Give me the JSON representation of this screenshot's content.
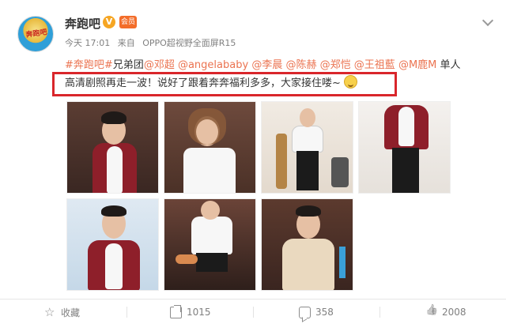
{
  "header": {
    "username": "奔跑吧",
    "verified_icon": "V",
    "avatar_logo": "奔跑吧",
    "member_icon": "会员",
    "time": "今天 17:01",
    "source_prefix": "来自",
    "device": "OPPO超视野全面屏R15"
  },
  "post": {
    "hashtag": "#奔跑吧#",
    "text_after_hashtag": "兄弟团",
    "mentions": [
      "@邓超",
      "@angelababy",
      "@李晨",
      "@陈赫",
      "@郑恺",
      "@王祖藍",
      "@M鹿M"
    ],
    "text_end_line1": "单人",
    "line2": "高清剧照再走一波！说好了跟着奔奔福利多多，大家接住喽~"
  },
  "photos": [
    {
      "label": "photo-1"
    },
    {
      "label": "photo-2"
    },
    {
      "label": "photo-3"
    },
    {
      "label": "photo-4"
    },
    {
      "label": "photo-5"
    },
    {
      "label": "photo-6"
    },
    {
      "label": "photo-7"
    }
  ],
  "actions": {
    "favorite_label": "收藏",
    "share_count": "1015",
    "comment_count": "358",
    "like_count": "2008"
  },
  "colors": {
    "link": "#eb7350",
    "highlight_border": "#d9262b",
    "verified_badge": "#f6a623"
  }
}
